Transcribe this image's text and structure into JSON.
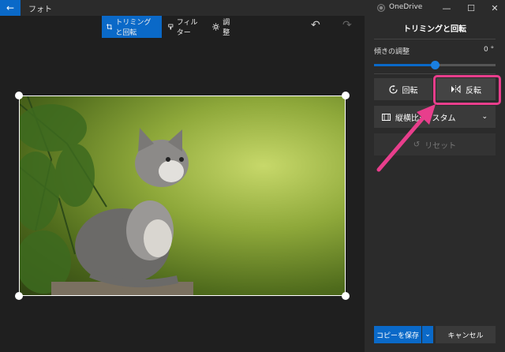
{
  "titlebar": {
    "back_icon": "←",
    "app_title": "フォト",
    "onedrive_label": "OneDrive",
    "minimize": "—",
    "maximize": "☐",
    "close": "✕"
  },
  "toolbar": {
    "crop_rotate": "トリミングと回転",
    "filter": "フィルター",
    "adjust": "調整",
    "undo": "↶",
    "redo": "↷"
  },
  "panel": {
    "title": "トリミングと回転",
    "straighten_label": "傾きの調整",
    "straighten_value": "0 °",
    "straighten_fraction": 0.5,
    "rotate_label": "回転",
    "flip_label": "反転",
    "aspect_ratio_label": "縦横比: カスタム",
    "reset_label": "リセット",
    "save_copy_label": "コピーを保存",
    "cancel_label": "キャンセル"
  },
  "colors": {
    "accent": "#0a69c8",
    "highlight": "#e83e8c"
  }
}
